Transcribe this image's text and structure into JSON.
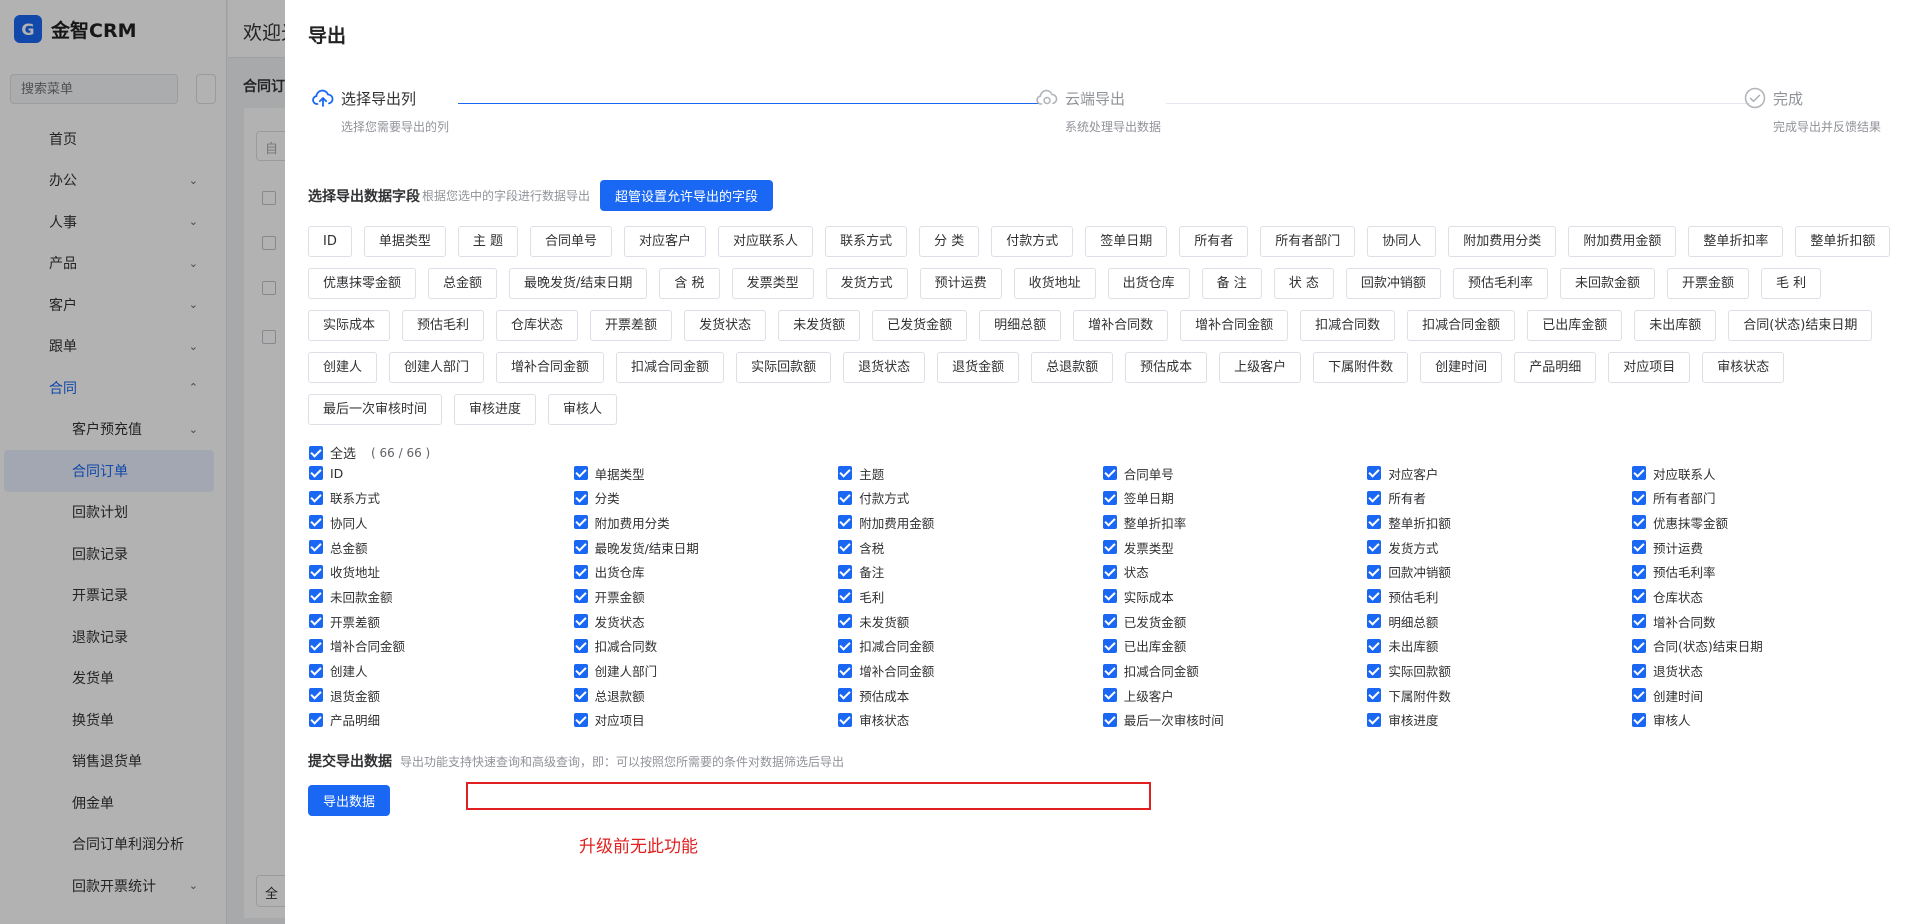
{
  "app": {
    "logo_text": "金智CRM",
    "welcome": "欢迎光"
  },
  "sidebar": {
    "search_placeholder": "搜索菜单",
    "items": [
      {
        "label": "首页",
        "chev": ""
      },
      {
        "label": "办公",
        "chev": "⌄"
      },
      {
        "label": "人事",
        "chev": "⌄"
      },
      {
        "label": "产品",
        "chev": "⌄"
      },
      {
        "label": "客户",
        "chev": "⌄"
      },
      {
        "label": "跟单",
        "chev": "⌄"
      },
      {
        "label": "合同",
        "chev": "⌃"
      }
    ],
    "sub_items": [
      {
        "label": "客户预充值",
        "chev": "⌄"
      },
      {
        "label": "合同订单",
        "chev": ""
      },
      {
        "label": "回款计划",
        "chev": ""
      },
      {
        "label": "回款记录",
        "chev": ""
      },
      {
        "label": "开票记录",
        "chev": ""
      },
      {
        "label": "退款记录",
        "chev": ""
      },
      {
        "label": "发货单",
        "chev": ""
      },
      {
        "label": "换货单",
        "chev": ""
      },
      {
        "label": "销售退货单",
        "chev": ""
      },
      {
        "label": "佣金单",
        "chev": ""
      },
      {
        "label": "合同订单利润分析",
        "chev": ""
      },
      {
        "label": "回款开票统计",
        "chev": "⌄"
      }
    ]
  },
  "background": {
    "tab_label": "合同订",
    "input_text": "自",
    "select_all_btn": "全"
  },
  "drawer": {
    "title": "导出",
    "steps": [
      {
        "title": "选择导出列",
        "desc": "选择您需要导出的列"
      },
      {
        "title": "云端导出",
        "desc": "系统处理导出数据"
      },
      {
        "title": "完成",
        "desc": "完成导出并反馈结果"
      }
    ],
    "fields_section": {
      "heading": "选择导出数据字段",
      "tip": "根据您选中的字段进行数据导出",
      "super_button": "超管设置允许导出的字段"
    },
    "tags": [
      "ID",
      "单据类型",
      "主 题",
      "合同单号",
      "对应客户",
      "对应联系人",
      "联系方式",
      "分 类",
      "付款方式",
      "签单日期",
      "所有者",
      "所有者部门",
      "协同人",
      "附加费用分类",
      "附加费用金额",
      "整单折扣率",
      "整单折扣额",
      "优惠抹零金额",
      "总金额",
      "最晚发货/结束日期",
      "含 税",
      "发票类型",
      "发货方式",
      "预计运费",
      "收货地址",
      "出货仓库",
      "备 注",
      "状 态",
      "回款冲销额",
      "预估毛利率",
      "未回款金额",
      "开票金额",
      "毛 利",
      "实际成本",
      "预估毛利",
      "仓库状态",
      "开票差额",
      "发货状态",
      "未发货额",
      "已发货金额",
      "明细总额",
      "增补合同数",
      "增补合同金额",
      "扣减合同数",
      "扣减合同金额",
      "已出库金额",
      "未出库额",
      "合同(状态)结束日期",
      "创建人",
      "创建人部门",
      "增补合同金额",
      "扣减合同金额",
      "实际回款额",
      "退货状态",
      "退货金额",
      "总退款额",
      "预估成本",
      "上级客户",
      "下属附件数",
      "创建时间",
      "产品明细",
      "对应项目",
      "审核状态",
      "最后一次审核时间",
      "审核进度",
      "审核人"
    ],
    "select_all": {
      "label": "全选",
      "count": "( 66 / 66 )"
    },
    "checkboxes": [
      "ID",
      "单据类型",
      "主题",
      "合同单号",
      "对应客户",
      "对应联系人",
      "联系方式",
      "分类",
      "付款方式",
      "签单日期",
      "所有者",
      "所有者部门",
      "协同人",
      "附加费用分类",
      "附加费用金额",
      "整单折扣率",
      "整单折扣额",
      "优惠抹零金额",
      "总金额",
      "最晚发货/结束日期",
      "含税",
      "发票类型",
      "发货方式",
      "预计运费",
      "收货地址",
      "出货仓库",
      "备注",
      "状态",
      "回款冲销额",
      "预估毛利率",
      "未回款金额",
      "开票金额",
      "毛利",
      "实际成本",
      "预估毛利",
      "仓库状态",
      "开票差额",
      "发货状态",
      "未发货额",
      "已发货金额",
      "明细总额",
      "增补合同数",
      "增补合同金额",
      "扣减合同数",
      "扣减合同金额",
      "已出库金额",
      "未出库额",
      "合同(状态)结束日期",
      "创建人",
      "创建人部门",
      "增补合同金额",
      "扣减合同金额",
      "实际回款额",
      "退货状态",
      "退货金额",
      "总退款额",
      "预估成本",
      "上级客户",
      "下属附件数",
      "创建时间",
      "产品明细",
      "对应项目",
      "审核状态",
      "最后一次审核时间",
      "审核进度",
      "审核人"
    ],
    "submit_section": {
      "heading": "提交导出数据",
      "tip": "导出功能支持快速查询和高级查询，即：可以按照您所需要的条件对数据筛选后导出",
      "export_button": "导出数据"
    },
    "annotation": "升级前无此功能",
    "colors": {
      "primary": "#1967f2",
      "annotation_red": "#e02020"
    }
  }
}
